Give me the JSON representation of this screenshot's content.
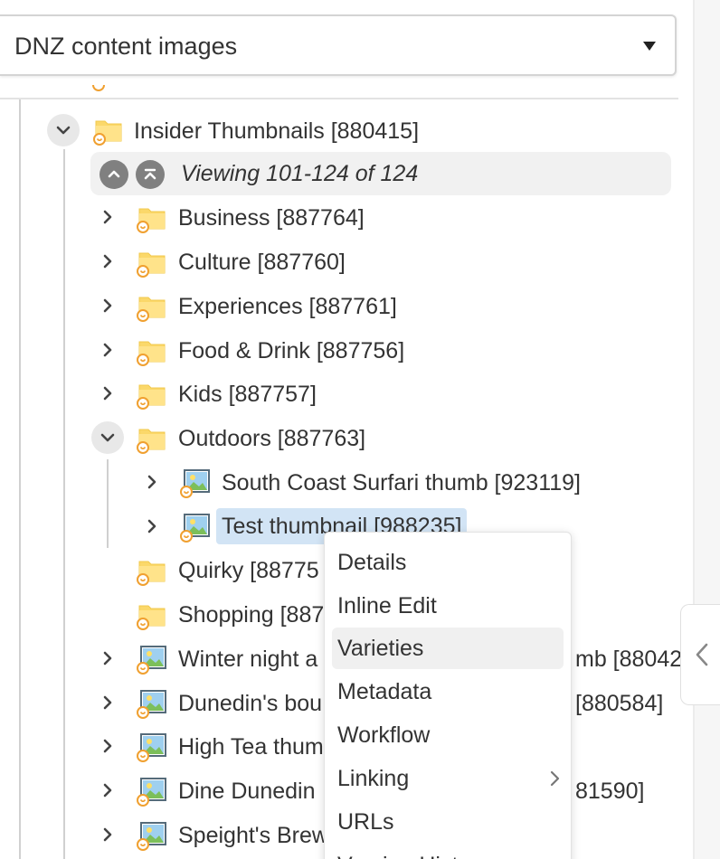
{
  "repository_select": {
    "selected": "DNZ content images"
  },
  "tree": {
    "parent": {
      "label": "Insider Thumbnails [880415]",
      "expanded": true
    },
    "paging": {
      "text": "Viewing 101-124 of 124"
    },
    "children": [
      {
        "label": "Business [887764]",
        "type": "folder",
        "expanded": false
      },
      {
        "label": "Culture [887760]",
        "type": "folder",
        "expanded": false
      },
      {
        "label": "Experiences [887761]",
        "type": "folder",
        "expanded": false
      },
      {
        "label": "Food & Drink [887756]",
        "type": "folder",
        "expanded": false
      },
      {
        "label": "Kids [887757]",
        "type": "folder",
        "expanded": false
      },
      {
        "label": "Outdoors [887763]",
        "type": "folder",
        "expanded": true,
        "children": [
          {
            "label": "South Coast Surfari thumb [923119]",
            "type": "image"
          },
          {
            "label": "Test thumbnail [988235]",
            "type": "image",
            "selected": true
          }
        ]
      },
      {
        "label": "Quirky [88775",
        "type": "folder"
      },
      {
        "label": "Shopping [887",
        "type": "folder"
      },
      {
        "label": "Winter night a",
        "label_tail": "mb [88042",
        "type": "image"
      },
      {
        "label": "Dunedin's bou",
        "label_tail": "[880584]",
        "type": "image"
      },
      {
        "label": "High Tea thum",
        "type": "image"
      },
      {
        "label": "Dine Dunedin",
        "label_tail": "81590]",
        "type": "image"
      },
      {
        "label": "Speight's Brew",
        "type": "image"
      }
    ]
  },
  "context_menu": {
    "items": [
      {
        "label": "Details"
      },
      {
        "label": "Inline Edit"
      },
      {
        "label": "Varieties",
        "hovered": true
      },
      {
        "label": "Metadata"
      },
      {
        "label": "Workflow"
      },
      {
        "label": "Linking",
        "has_submenu": true
      },
      {
        "label": "URLs"
      },
      {
        "label": "Version History"
      }
    ]
  },
  "colors": {
    "folder": "#fbd86a",
    "folder_dark": "#f2c94c",
    "workflow_badge": "#f0a030",
    "selection": "#d2e4f5",
    "hover": "#f0f0f0"
  },
  "icons": {
    "expand": "chevron-right-icon",
    "collapse": "chevron-down-icon",
    "folder": "folder-icon",
    "image": "image-thumbnail-icon",
    "paging_up": "chevron-up-icon",
    "paging_first": "page-first-icon",
    "panel_collapse": "chevron-left-icon"
  }
}
